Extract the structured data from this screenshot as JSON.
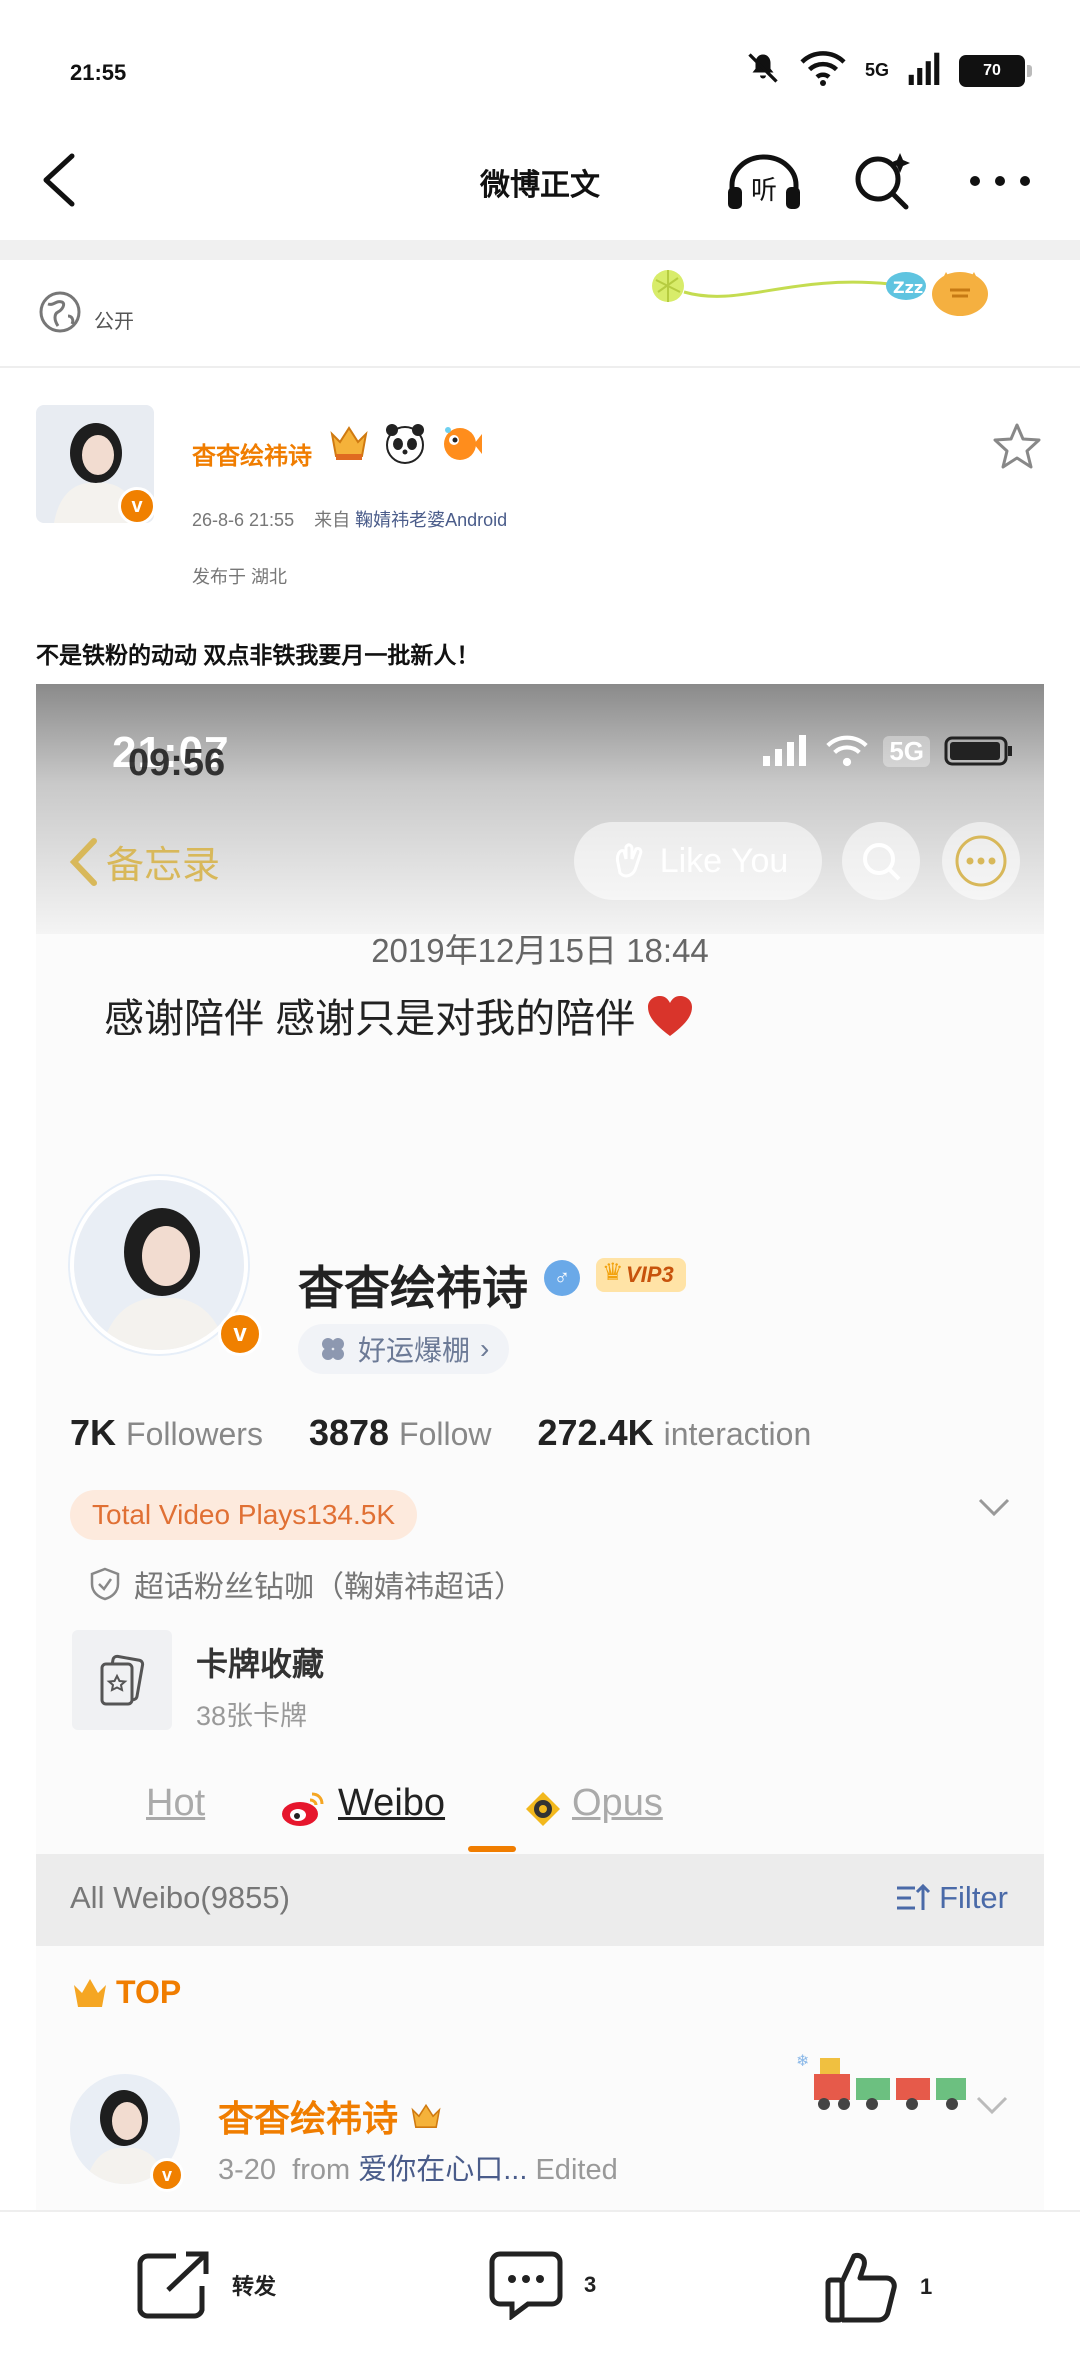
{
  "status_bar": {
    "time": "21:55",
    "network": "5G",
    "battery": "70"
  },
  "nav": {
    "title": "微博正文",
    "listen_label": "听"
  },
  "visibility": {
    "label": "公开"
  },
  "post": {
    "author": "杳杳绘祎诗",
    "verified_mark": "v",
    "timestamp": "26-8-6 21:55",
    "source_prefix": "来自",
    "source": "鞠婧祎老婆Android",
    "location": "发布于 湖北",
    "text": "不是铁粉的动动 双点非铁我要月一批新人！"
  },
  "screenshot": {
    "status_time": "21:07",
    "status_time_overlay": "09:56",
    "status_network": "5G",
    "memo_back_label": "备忘录",
    "like_you_label": "Like You",
    "memo_date": "2019年12月15日 18:44",
    "memo_text": "感谢陪伴 感谢只是对我的陪伴",
    "profile": {
      "name": "杳杳绘祎诗",
      "gender": "♂",
      "vip": "VIP3",
      "luck_tag": "好运爆棚",
      "luck_arrow": "›",
      "followers_count": "7K",
      "followers_label": "Followers",
      "follow_count": "3878",
      "follow_label": "Follow",
      "interaction_count": "272.4K",
      "interaction_label": "interaction",
      "video_plays": "Total Video Plays134.5K",
      "super_topic": "超话粉丝钻咖（鞠婧祎超话）",
      "card_title": "卡牌收藏",
      "card_sub": "38张卡牌",
      "tabs": [
        "Hot",
        "Weibo",
        "Opus"
      ],
      "active_tab": "Weibo",
      "all_weibo": "All Weibo(9855)",
      "filter_label": "Filter",
      "top_label": "TOP",
      "feed_name": "杳杳绘祎诗",
      "feed_date": "3-20",
      "feed_from": "from",
      "feed_source": "爱你在心口...",
      "feed_edited": "Edited"
    }
  },
  "actions": {
    "repost_label": "转发",
    "comment_count": "3",
    "like_count": "1"
  },
  "colors": {
    "accent": "#f07d00",
    "link": "#4a5c8a",
    "vip_bg": "#ffe3a6"
  }
}
